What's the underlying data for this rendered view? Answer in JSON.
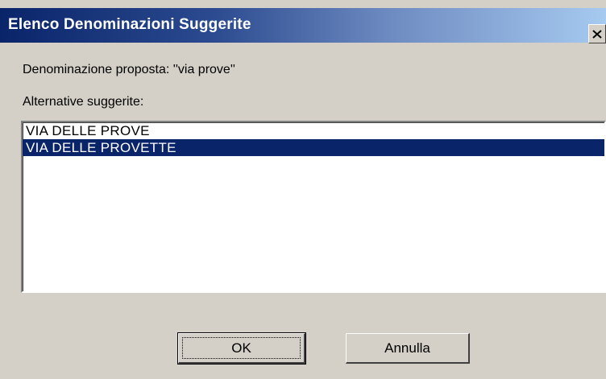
{
  "window": {
    "title": "Elenco Denominazioni Suggerite",
    "close_icon": "close-icon"
  },
  "content": {
    "proposed_label": "Denominazione proposta: ''via prove''",
    "alternatives_label": "Alternative suggerite:"
  },
  "list": {
    "items": [
      {
        "label": "VIA DELLE PROVE",
        "selected": false
      },
      {
        "label": "VIA DELLE PROVETTE",
        "selected": true
      }
    ]
  },
  "buttons": {
    "ok_label": "OK",
    "cancel_label": "Annulla"
  },
  "colors": {
    "face": "#d4d0c8",
    "title_start": "#0a246a",
    "title_end": "#a6caf0",
    "selection": "#0a246a"
  }
}
